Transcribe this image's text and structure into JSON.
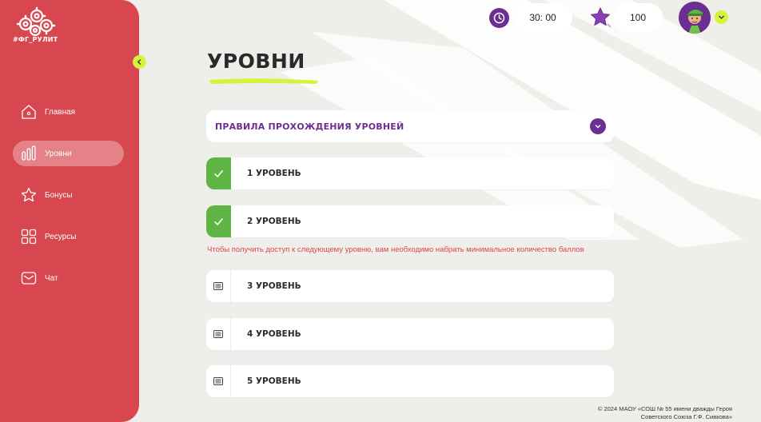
{
  "brand": {
    "logo_text": "#ФГ_РУЛИТ"
  },
  "sidebar": {
    "items": [
      {
        "label": "Главная",
        "icon": "home-icon",
        "active": false
      },
      {
        "label": "Уровни",
        "icon": "levels-bars-icon",
        "active": true
      },
      {
        "label": "Бонусы",
        "icon": "star-outline-icon",
        "active": false
      },
      {
        "label": "Ресурсы",
        "icon": "grid-icon",
        "active": false
      },
      {
        "label": "Чат",
        "icon": "mail-icon",
        "active": false
      }
    ]
  },
  "topbar": {
    "timer": "30: 00",
    "score": "100",
    "icons": [
      "clock-icon",
      "star-icon",
      "avatar",
      "chevron-down-icon"
    ]
  },
  "main": {
    "title": "УРОВНИ",
    "rules_label": "ПРАВИЛА ПРОХОЖДЕНИЯ УРОВНЕЙ",
    "levels": [
      {
        "label": "1 УРОВЕНЬ",
        "status": "completed"
      },
      {
        "label": "2 УРОВЕНЬ",
        "status": "completed"
      },
      {
        "label": "3 УРОВЕНЬ",
        "status": "locked"
      },
      {
        "label": "4 УРОВЕНЬ",
        "status": "locked"
      },
      {
        "label": "5 УРОВЕНЬ",
        "status": "locked"
      }
    ],
    "warning": "Чтобы получить доступ к следующему уровню, вам необходимо набрать минимальное количество баллов"
  },
  "footer": {
    "line1": "© 2024 МАОУ «СОШ № 55 имени дважды Героя",
    "line2": "Советского Союза Г.Ф. Сивкова»"
  },
  "colors": {
    "sidebar": "#d8474f",
    "accent_purple": "#6b2f91",
    "accent_lime": "#d7f23a",
    "success_green": "#5fb544",
    "background": "#efeeea"
  }
}
